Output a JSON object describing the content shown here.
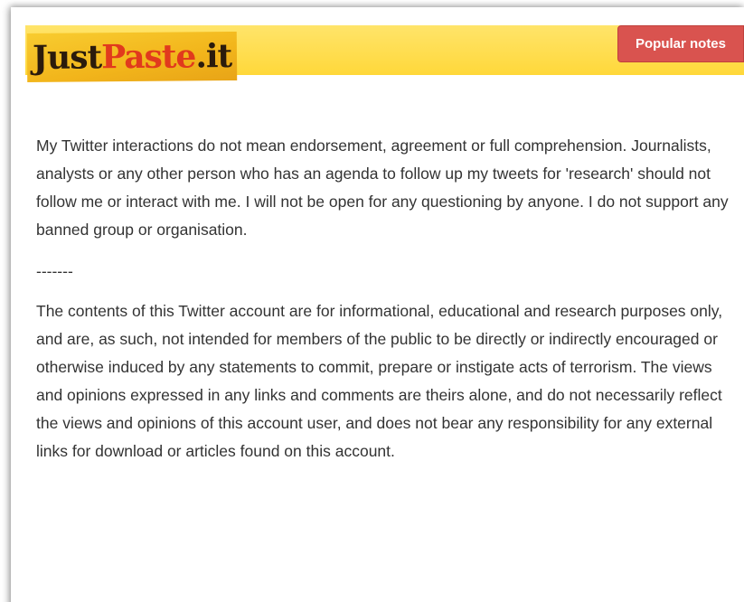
{
  "header": {
    "logo": {
      "part1": "Just",
      "part2": "Paste",
      "part3": ".it"
    },
    "popular_notes_label": "Popular notes"
  },
  "content": {
    "paragraph1": "My Twitter interactions do not mean endorsement, agreement or full comprehension. Journalists, analysts or any other person who has an agenda to follow up my tweets for 'research' should not follow me or interact with me. I will not be open for any questioning by anyone. I do not support any banned group or organisation.",
    "separator": "-------",
    "paragraph2": "The contents of this Twitter account are for informational, educational and research purposes only, and are, as such, not intended for members of the public to be directly or indirectly encouraged or otherwise induced by any statements to commit, prepare or instigate acts of terrorism. The views and opinions expressed in any links and comments are theirs alone, and do not necessarily reflect the views and opinions of this account user, and does not bear any responsibility for any external links for download or articles found on this account."
  },
  "colors": {
    "header_bg": "#ffdd4d",
    "button_bg": "#d9534f",
    "logo_dark": "#2b1b0c",
    "logo_red": "#e13a1d",
    "text": "#333333"
  }
}
